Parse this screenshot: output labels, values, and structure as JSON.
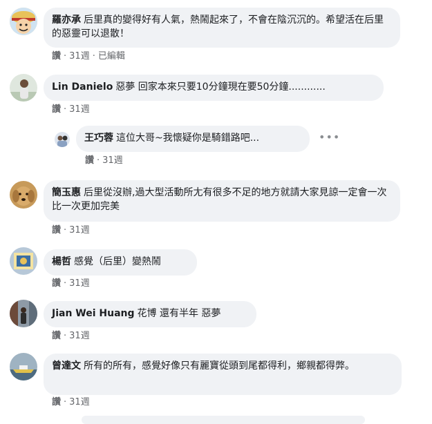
{
  "comments": [
    {
      "author": "羅亦承",
      "text": "后里真的變得好有人氣，熱鬧起來了，不會在陰沉沉的。希望活在后里的惡靈可以退散！",
      "like": "讚",
      "time": "31週",
      "edited": "已編輯",
      "avatar_icon": "luffy-avatar-icon"
    },
    {
      "author": "Lin Danielo",
      "text": "惡夢 回家本來只要10分鐘現在要50分鐘............",
      "like": "讚",
      "time": "31週",
      "avatar_icon": "person-avatar-icon"
    },
    {
      "author": "王巧蓉",
      "text": "這位大哥~我懷疑你是騎錯路吧...",
      "like": "讚",
      "time": "31週",
      "more": "•••",
      "avatar_icon": "person-avatar-icon"
    },
    {
      "author": "簡玉惠",
      "text": "后里從沒辦,過大型活動所尢有很多不足的地方就請大家見諒一定會一次比一次更加完美",
      "like": "讚",
      "time": "31週",
      "avatar_icon": "dog-avatar-icon"
    },
    {
      "author": "楊哲",
      "text": "感覺（后里）變熱鬧",
      "like": "讚",
      "time": "31週",
      "avatar_icon": "picture-avatar-icon"
    },
    {
      "author": "Jian Wei Huang",
      "text": "花博 還有半年 惡夢",
      "like": "讚",
      "time": "31週",
      "avatar_icon": "person-avatar-icon"
    },
    {
      "author": "曾達文",
      "text": "所有的所有，感覺好像只有麗寶從頭到尾都得利，鄉親都得弊。",
      "like": "讚",
      "time": "31週",
      "avatar_icon": "boat-avatar-icon"
    }
  ]
}
